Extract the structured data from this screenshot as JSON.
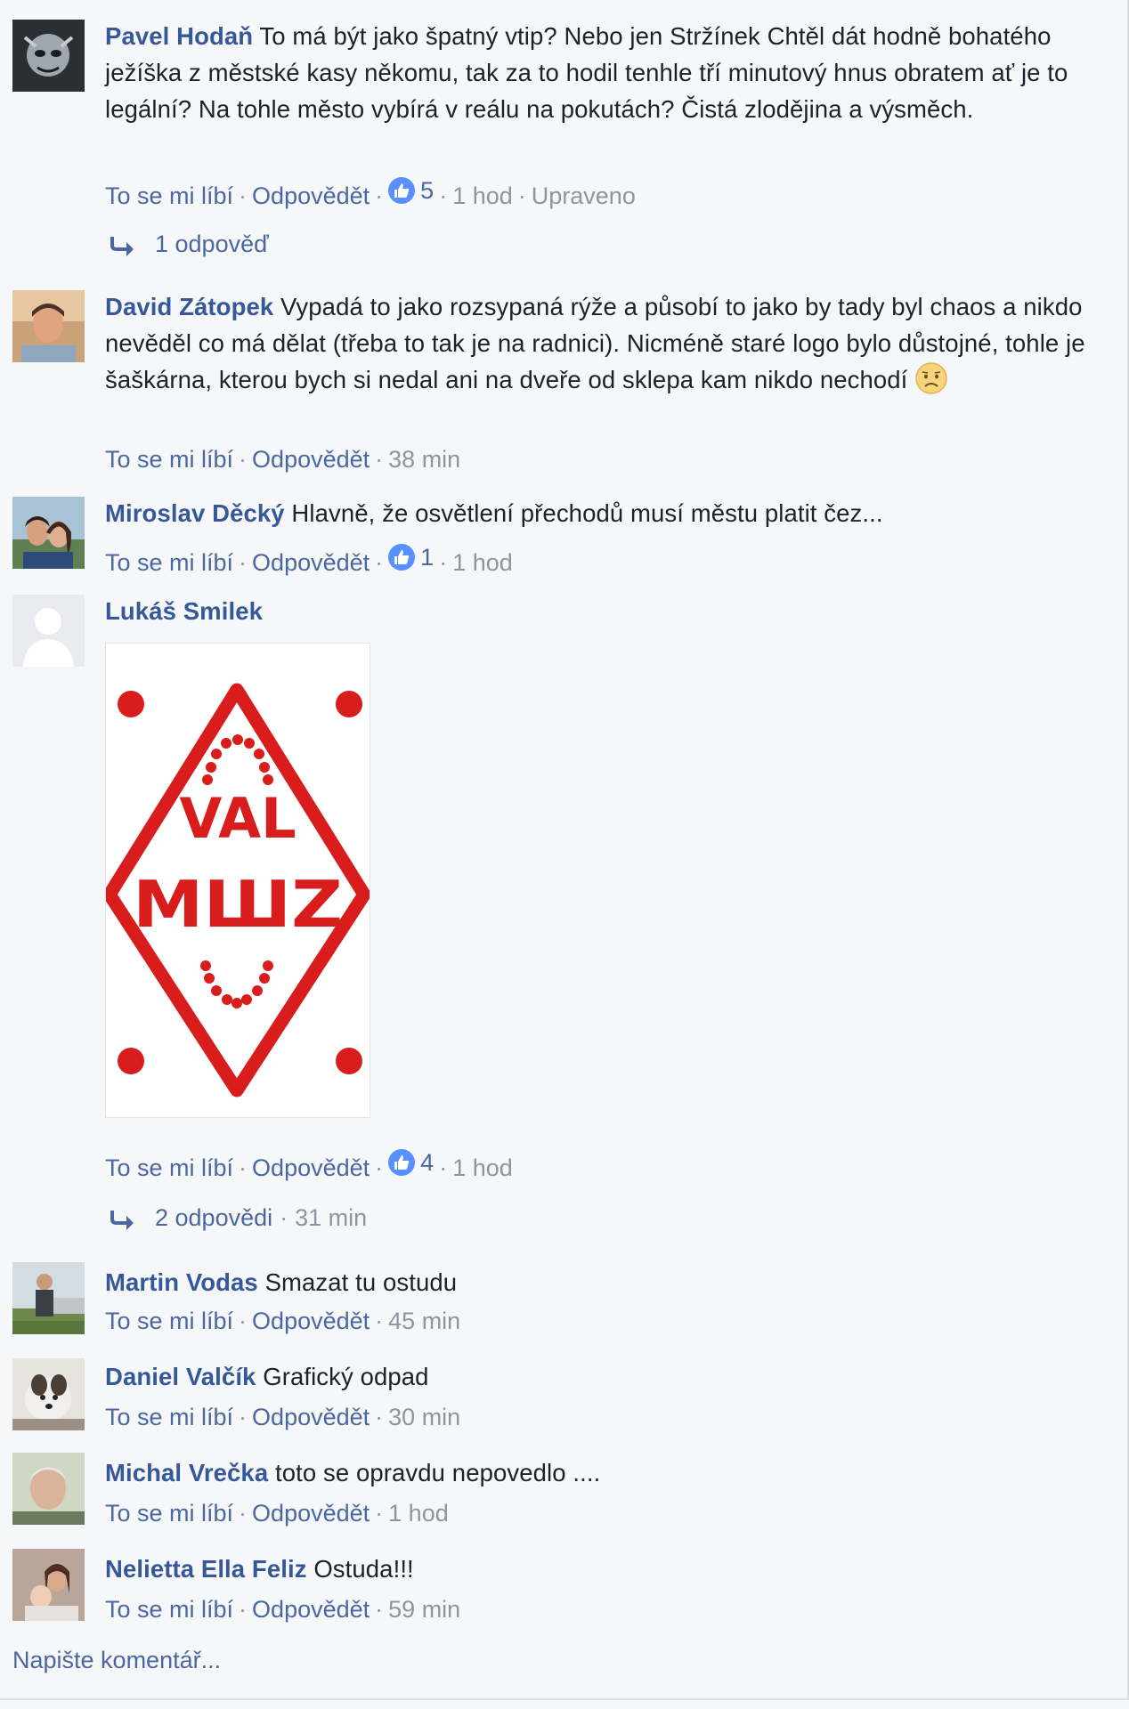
{
  "labels": {
    "like": "To se mi líbí",
    "reply": "Odpovědět",
    "edited": "Upraveno",
    "write_comment": "Napište komentář..."
  },
  "colors": {
    "author": "#365899",
    "meta_link": "#4b67a1",
    "meta_muted": "#90949c",
    "like_badge": "#5890ff",
    "logo_red": "#d91c1c"
  },
  "comments": [
    {
      "author": "Pavel Hodaň",
      "text": "To má být jako špatný vtip? Nebo jen Stržínek Chtěl dát hodně bohatého ježíška z městské kasy někomu, tak za to hodil tenhle tří minutový hnus obratem ať je to legální? Na tohle město vybírá v reálu na pokutách? Čistá zlodějina a výsměch.",
      "likes": "5",
      "time": "1 hod",
      "replies": "1 odpověď"
    },
    {
      "author": "David Zátopek",
      "text": "Vypadá to jako rozsypaná rýže a působí to jako by tady byl chaos a nikdo nevěděl co má dělat (třeba to tak je na radnici). Nicméně staré logo bylo důstojné, tohle je šaškárna, kterou bych si nedal ani na dveře od sklepa kam nikdo nechodí",
      "emoji": "disappointed-face-icon",
      "time": "38 min"
    },
    {
      "author": "Miroslav Děcký",
      "text": "Hlavně, že osvětlení přechodů musí městu platit čez...",
      "likes": "1",
      "time": "1 hod"
    },
    {
      "author": "Lukáš Smilek",
      "text": "",
      "attachment": {
        "lines": [
          "VAL",
          "MШZ"
        ]
      },
      "likes": "4",
      "time": "1 hod",
      "replies": "2 odpovědi",
      "replies_time": "31 min"
    },
    {
      "author": "Martin Vodas",
      "text": "Smazat tu ostudu",
      "time": "45 min"
    },
    {
      "author": "Daniel Valčík",
      "text": "Grafický odpad",
      "time": "30 min"
    },
    {
      "author": "Michal Vrečka",
      "text": "toto se opravdu nepovedlo ....",
      "time": "1 hod"
    },
    {
      "author": "Nelietta Ella Feliz",
      "text": "Ostuda!!!",
      "time": "59 min"
    }
  ]
}
